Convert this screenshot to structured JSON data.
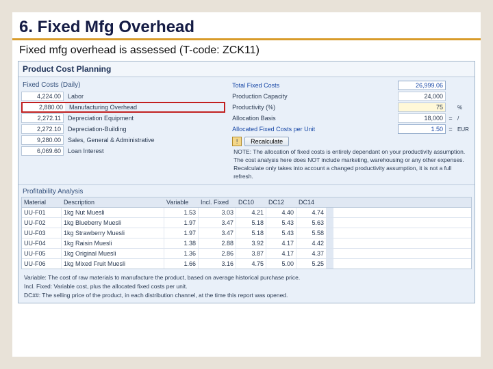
{
  "title": "6. Fixed Mfg Overhead",
  "subtitle": "Fixed mfg overhead is assessed (T-code: ZCK11)",
  "app_header": "Product Cost Planning",
  "fixed_costs": {
    "group_title": "Fixed Costs (Daily)",
    "rows": [
      {
        "value": "4,224.00",
        "label": "Labor"
      },
      {
        "value": "2,880.00",
        "label": "Manufacturing Overhead"
      },
      {
        "value": "2,272.11",
        "label": "Depreciation Equipment"
      },
      {
        "value": "2,272.10",
        "label": "Depreciation-Building"
      },
      {
        "value": "9,280.00",
        "label": "Sales, General & Administrative"
      },
      {
        "value": "6,069.60",
        "label": "Loan Interest"
      }
    ]
  },
  "alloc": {
    "total_label": "Total Fixed Costs",
    "total_value": "26,999.06",
    "capacity_label": "Production Capacity",
    "capacity_value": "24,000",
    "productivity_label": "Productivity (%)",
    "productivity_value": "75",
    "productivity_unit": "%",
    "basis_label": "Allocation Basis",
    "basis_value": "18,000",
    "basis_sym": "=",
    "basis_unit": "/",
    "perunit_label": "Allocated Fixed Costs per Unit",
    "perunit_value": "1.50",
    "perunit_sym": "=",
    "perunit_unit": "EUR",
    "recalc": "Recalculate",
    "note": "NOTE: The allocation of fixed costs is entirely dependant on your productivity assumption. The cost analysis here does NOT include marketing, warehousing or any other expenses. Recalculate only takes into account a changed productivity assumption, it is not a full refresh."
  },
  "pa": {
    "title": "Profitability Analysis",
    "headers": [
      "Material",
      "Description",
      "Variable",
      "Incl. Fixed",
      "DC10",
      "DC12",
      "DC14"
    ],
    "rows": [
      [
        "UU-F01",
        "1kg Nut Muesli",
        "1.53",
        "3.03",
        "4.21",
        "4.40",
        "4.74"
      ],
      [
        "UU-F02",
        "1kg Blueberry Muesli",
        "1.97",
        "3.47",
        "5.18",
        "5.43",
        "5.63"
      ],
      [
        "UU-F03",
        "1kg Strawberry Muesli",
        "1.97",
        "3.47",
        "5.18",
        "5.43",
        "5.58"
      ],
      [
        "UU-F04",
        "1kg Raisin Muesli",
        "1.38",
        "2.88",
        "3.92",
        "4.17",
        "4.42"
      ],
      [
        "UU-F05",
        "1kg Original Muesli",
        "1.36",
        "2.86",
        "3.87",
        "4.17",
        "4.37"
      ],
      [
        "UU-F06",
        "1kg Mixed Fruit Muesli",
        "1.66",
        "3.16",
        "4.75",
        "5.00",
        "5.25"
      ]
    ]
  },
  "defs": {
    "l1": "Variable: The cost of raw materials to manufacture the product, based on average historical purchase price.",
    "l2": "Incl. Fixed: Variable cost, plus the allocated fixed costs per unit.",
    "l3": "DC##: The selling price of the product, in each distribution channel, at the time this report was opened."
  }
}
